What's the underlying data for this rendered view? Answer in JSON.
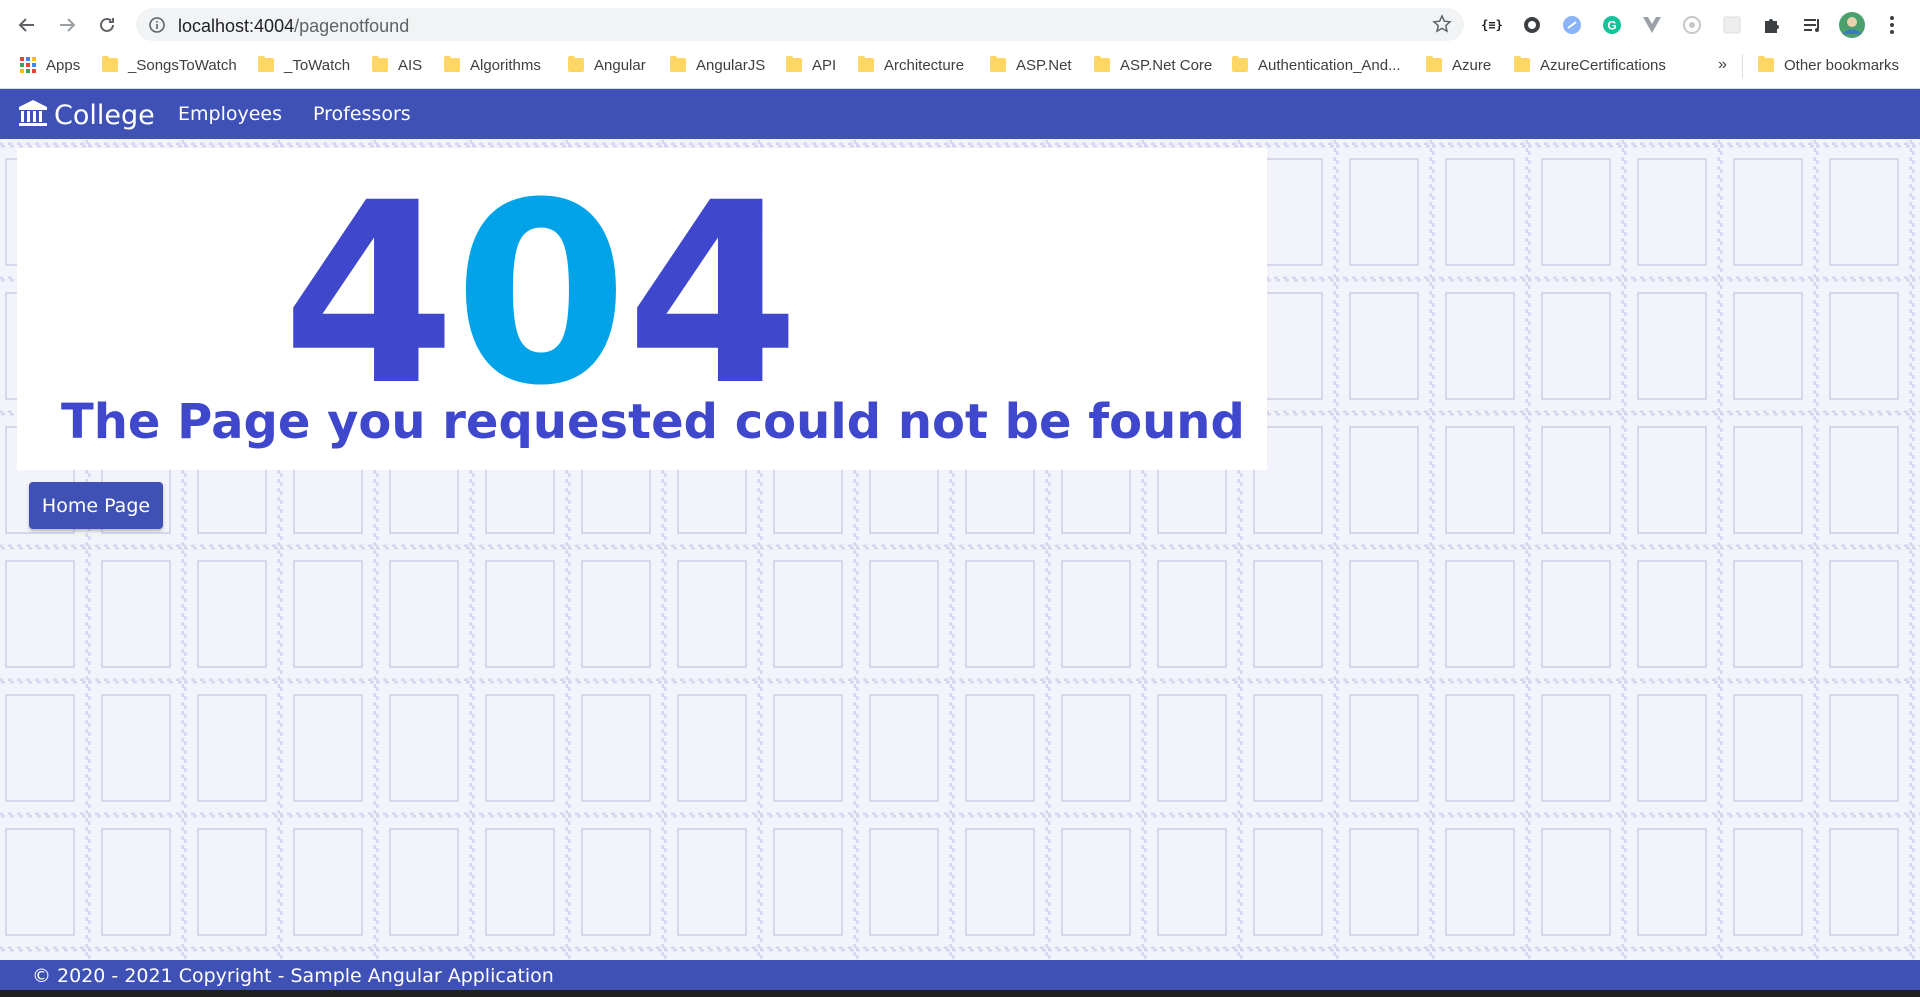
{
  "browser": {
    "url_host": "localhost:4004",
    "url_path": "/pagenotfound",
    "nav_icons": [
      "back-arrow-icon",
      "forward-arrow-icon",
      "reload-icon"
    ],
    "extensions": [
      "json-formatter-icon",
      "circle-extension-icon",
      "sync-extension-icon",
      "grammarly-icon",
      "vue-devtools-icon",
      "camera-extension-icon",
      "blank-extension-icon",
      "puzzle-piece-icon",
      "reading-list-icon",
      "profile-avatar-icon",
      "kebab-menu-icon"
    ],
    "bookmarks": [
      {
        "label": "Apps",
        "icon": "apps-grid-icon"
      },
      {
        "label": "_SongsToWatch",
        "icon": "folder-icon"
      },
      {
        "label": "_ToWatch",
        "icon": "folder-icon"
      },
      {
        "label": "AIS",
        "icon": "folder-icon"
      },
      {
        "label": "Algorithms",
        "icon": "folder-icon"
      },
      {
        "label": "Angular",
        "icon": "folder-icon"
      },
      {
        "label": "AngularJS",
        "icon": "folder-icon"
      },
      {
        "label": "API",
        "icon": "folder-icon"
      },
      {
        "label": "Architecture",
        "icon": "folder-icon"
      },
      {
        "label": "ASP.Net",
        "icon": "folder-icon"
      },
      {
        "label": "ASP.Net Core",
        "icon": "folder-icon"
      },
      {
        "label": "Authentication_And...",
        "icon": "folder-icon"
      },
      {
        "label": "Azure",
        "icon": "folder-icon"
      },
      {
        "label": "AzureCertifications",
        "icon": "folder-icon"
      }
    ],
    "overflow_label": "»",
    "other_bookmarks": "Other bookmarks"
  },
  "navbar": {
    "brand": "College",
    "brand_icon": "bank-building-icon",
    "links": [
      "Employees",
      "Professors"
    ]
  },
  "error": {
    "digit_1": "4",
    "digit_2": "0",
    "digit_3": "4",
    "message": "The Page you requested could not be found",
    "home_button": "Home Page"
  },
  "footer": {
    "text": "© 2020 - 2021 Copyright - Sample Angular Application"
  },
  "colors": {
    "brand": "#3f51b5",
    "accent_blue": "#00a2e8",
    "heading_indigo": "#3f47cc",
    "background": "#f3f3fb"
  }
}
